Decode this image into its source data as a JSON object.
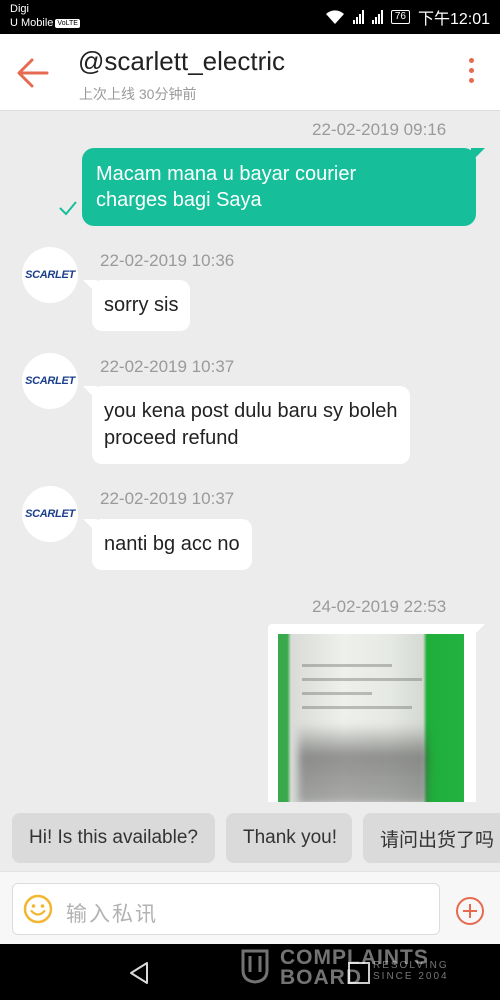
{
  "status_bar": {
    "carrier_1": "Digi",
    "carrier_2": "U Mobile",
    "volte_badge": "VoLTE",
    "battery": "76",
    "time": "下午12:01"
  },
  "header": {
    "title": "@scarlett_electric",
    "last_seen": "上次上线 30分钟前"
  },
  "messages": [
    {
      "sender": "me",
      "timestamp": "22-02-2019 09:16",
      "text": "Macam mana u bayar courier charges bagi Saya",
      "line1": "Macam mana u bayar courier",
      "line2": "charges bagi Saya"
    },
    {
      "sender": "seller",
      "avatar_text": "SCARLET",
      "timestamp": "22-02-2019 10:36",
      "text": "sorry sis"
    },
    {
      "sender": "seller",
      "avatar_text": "SCARLET",
      "timestamp": "22-02-2019 10:37",
      "text": "you kena post dulu baru sy boleh proceed refund",
      "line1": "you kena post dulu baru sy boleh",
      "line2": "proceed refund"
    },
    {
      "sender": "seller",
      "avatar_text": "SCARLET",
      "timestamp": "22-02-2019 10:37",
      "text": "nanti bg acc no"
    },
    {
      "sender": "me",
      "timestamp": "24-02-2019 22:53",
      "type": "image"
    }
  ],
  "quick_replies": [
    "Hi! Is this available?",
    "Thank you!",
    "请问出货了吗"
  ],
  "input": {
    "placeholder": "输入私讯"
  },
  "watermark": {
    "line1": "COMPLAINTS",
    "line2": "BOARD",
    "tag1": "RESOLVING",
    "tag2": "SINCE 2004"
  },
  "colors": {
    "accent": "#e66a4f",
    "my_bubble": "#16bf9a",
    "background": "#ececec"
  }
}
